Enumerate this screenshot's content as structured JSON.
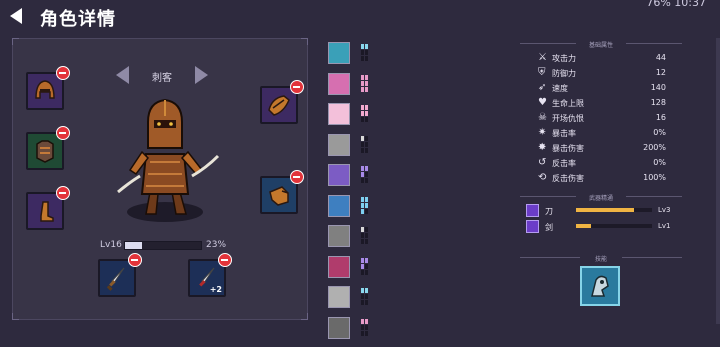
{
  "header": {
    "title": "角色详情",
    "status": "76% 10:37"
  },
  "character": {
    "class_name": "刺客",
    "level_label": "Lv16",
    "xp_percent_label": "23%",
    "xp_fraction": 0.23,
    "weapon2_plus": "+2"
  },
  "equipment_slots": [
    {
      "name": "helmet",
      "color": "purple"
    },
    {
      "name": "armor",
      "color": "green"
    },
    {
      "name": "boots",
      "color": "purple"
    },
    {
      "name": "shoulder",
      "color": "purple"
    },
    {
      "name": "gloves",
      "color": "blue"
    },
    {
      "name": "weapon-1",
      "color": "navy"
    },
    {
      "name": "weapon-2",
      "color": "navy"
    }
  ],
  "collection": [
    {
      "icon": "ice-creature-icon",
      "bg": "#3aa0b8",
      "bars": [
        "#8ad8ee",
        "#8ad8ee",
        "#1b1826",
        "#1b1826",
        "#1b1826",
        "#1b1826"
      ]
    },
    {
      "icon": "wolf-icon",
      "bg": "#d66fb0",
      "bars": [
        "#e89ac8",
        "#e89ac8",
        "#e89ac8",
        "#e89ac8",
        "#e89ac8",
        "#e89ac8"
      ]
    },
    {
      "icon": "fist-icon",
      "bg": "#f3c0da",
      "bars": [
        "#f3a9cf",
        "#f3a9cf",
        "#f3a9cf",
        "#f3a9cf",
        "#1b1826",
        "#1b1826"
      ]
    },
    {
      "icon": "armor-icon",
      "bg": "#9a9a9a",
      "bars": [
        "#d9d9d9",
        "#1b1826",
        "#1b1826",
        "#1b1826",
        "#1b1826",
        "#1b1826"
      ]
    },
    {
      "icon": "robot-icon",
      "bg": "#7c5cc4",
      "bars": [
        "#a88ae8",
        "#a88ae8",
        "#a88ae8",
        "#1b1826",
        "#1b1826",
        "#1b1826"
      ]
    },
    {
      "icon": "dragon-icon",
      "bg": "#3e7fc0",
      "bars": [
        "#7ecff0",
        "#7ecff0",
        "#7ecff0",
        "#7ecff0",
        "#7ecff0",
        "#1b1826"
      ]
    },
    {
      "icon": "wolf-grey-icon",
      "bg": "#808080",
      "bars": [
        "#d9d9d9",
        "#1b1826",
        "#1b1826",
        "#1b1826",
        "#1b1826",
        "#1b1826"
      ]
    },
    {
      "icon": "blob-icon",
      "bg": "#b03c6c",
      "bars": [
        "#a88ae8",
        "#a88ae8",
        "#a88ae8",
        "#1b1826",
        "#1b1826",
        "#1b1826"
      ]
    },
    {
      "icon": "ghost-icon",
      "bg": "#b0b0b0",
      "bars": [
        "#8ad8ee",
        "#8ad8ee",
        "#1b1826",
        "#1b1826",
        "#1b1826",
        "#1b1826"
      ]
    },
    {
      "icon": "mech-icon",
      "bg": "#6a6a6a",
      "bars": [
        "#e89ac8",
        "#e89ac8",
        "#1b1826",
        "#1b1826",
        "#1b1826",
        "#1b1826"
      ]
    }
  ],
  "stats": {
    "title": "基础属性",
    "items": [
      {
        "icon": "sword-icon",
        "glyph": "⚔",
        "label": "攻击力",
        "value": "44"
      },
      {
        "icon": "shield-icon",
        "glyph": "⛨",
        "label": "防御力",
        "value": "12"
      },
      {
        "icon": "boot-icon",
        "glyph": "➶",
        "label": "速度",
        "value": "140"
      },
      {
        "icon": "heart-icon",
        "glyph": "♥",
        "label": "生命上限",
        "value": "128"
      },
      {
        "icon": "skull-icon",
        "glyph": "☠",
        "label": "开场仇恨",
        "value": "16"
      },
      {
        "icon": "crit-icon",
        "glyph": "✷",
        "label": "暴击率",
        "value": "0%"
      },
      {
        "icon": "crit-dmg-icon",
        "glyph": "✸",
        "label": "暴击伤害",
        "value": "200%"
      },
      {
        "icon": "counter-icon",
        "glyph": "↺",
        "label": "反击率",
        "value": "0%"
      },
      {
        "icon": "counter-dmg-icon",
        "glyph": "⟲",
        "label": "反击伤害",
        "value": "100%"
      }
    ]
  },
  "weapons": {
    "title": "武器精通",
    "items": [
      {
        "label": "刀",
        "level": "Lv3",
        "fraction": 0.76
      },
      {
        "label": "剑",
        "level": "Lv1",
        "fraction": 0.2
      }
    ]
  },
  "skill": {
    "title": "技能"
  }
}
